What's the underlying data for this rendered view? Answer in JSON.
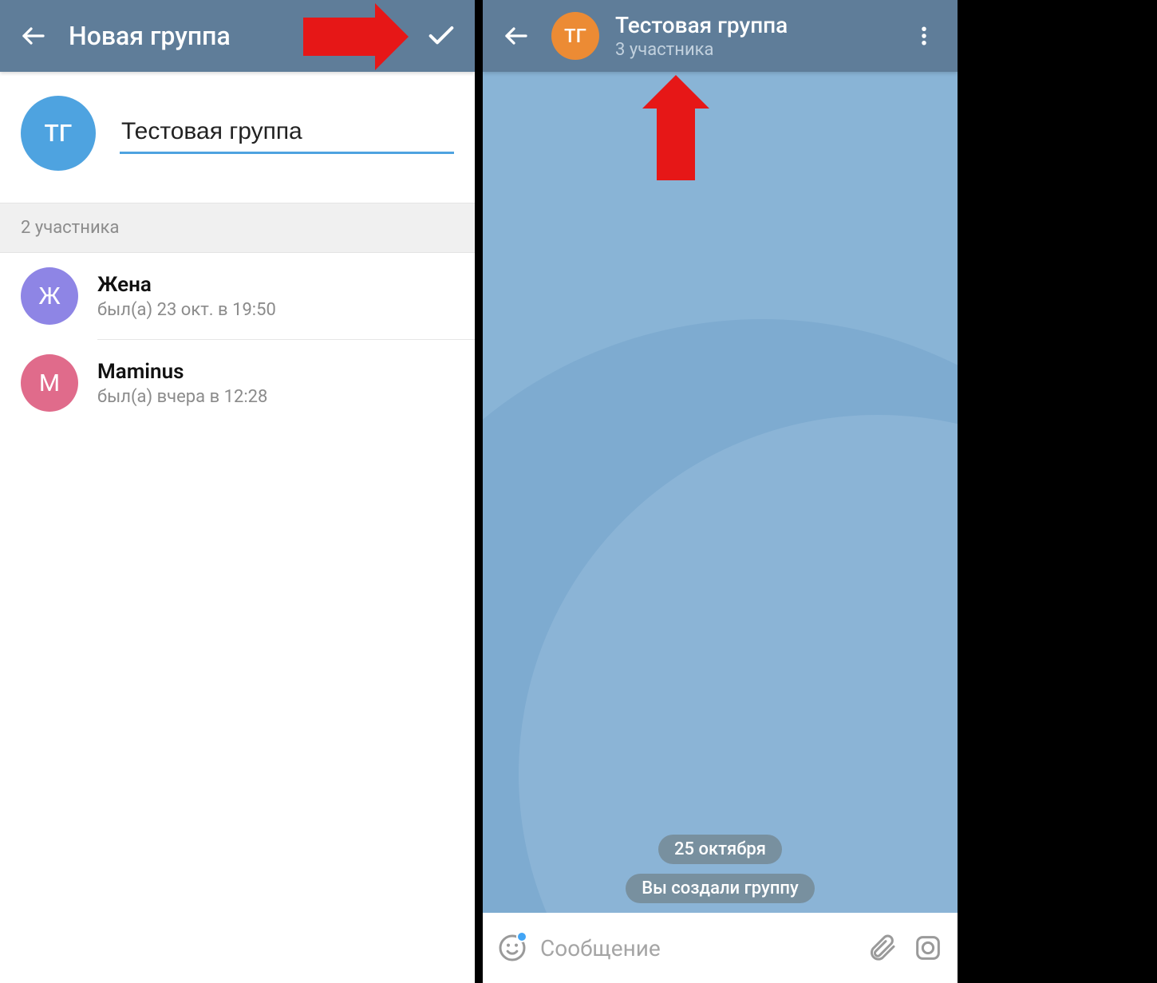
{
  "left": {
    "header": {
      "title": "Новая группа"
    },
    "group": {
      "avatar_initials": "ТГ",
      "avatar_color": "#4ea3e0",
      "name_input_value": "Тестовая группа"
    },
    "members_label": "2 участника",
    "members": [
      {
        "name": "Жена",
        "status": "был(а) 23 окт. в 19:50",
        "initial": "Ж",
        "color": "#8e85e5"
      },
      {
        "name": "Maminus",
        "status": "был(а) вчера в 12:28",
        "initial": "М",
        "color": "#e06b8b"
      }
    ]
  },
  "right": {
    "header": {
      "title": "Тестовая группа",
      "subtitle": "3 участника",
      "avatar_initials": "ТГ",
      "avatar_color": "#ec8b34"
    },
    "date_pill": "25 октября",
    "system_pill": "Вы создали группу",
    "composer_placeholder": "Сообщение"
  },
  "icons": {
    "back": "back-arrow-icon",
    "check": "check-icon",
    "more": "more-vert-icon",
    "sticker": "sticker-icon",
    "attach": "attach-icon",
    "mic": "mic-icon"
  }
}
